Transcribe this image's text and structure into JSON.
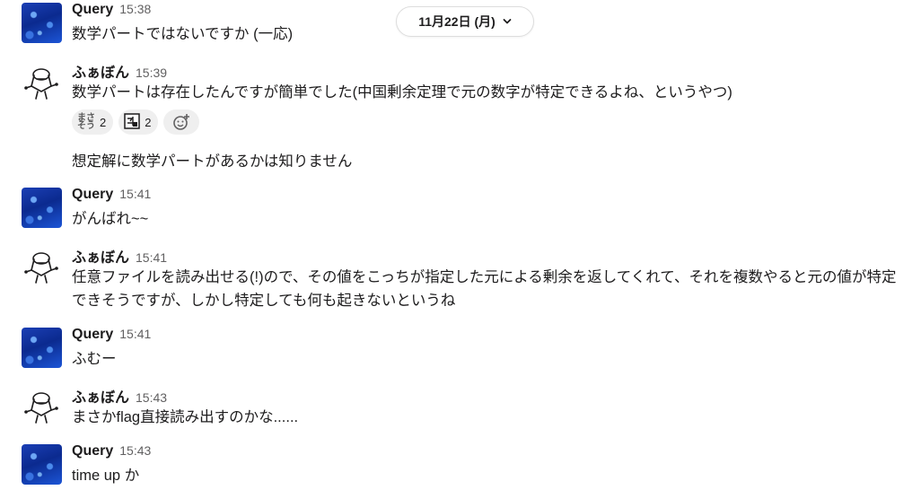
{
  "date_divider": {
    "label": "11月22日 (月)",
    "icon": "chevron-down-icon"
  },
  "messages": [
    {
      "name": "Query",
      "time": "15:38",
      "text": "数学パートではないですか (一応)",
      "avatar": "query"
    },
    {
      "name": "ふぁぼん",
      "time": "15:39",
      "text": "数学パートは存在したんですが簡単でした(中国剰余定理で元の数字が特定できるよね、というやつ)",
      "avatar": "fabon"
    },
    {
      "text": "想定解に数学パートがあるかは知りません"
    },
    {
      "name": "Query",
      "time": "15:41",
      "text": "がんばれ~~",
      "avatar": "query"
    },
    {
      "name": "ふぁぼん",
      "time": "15:41",
      "text": "任意ファイルを読み出せる(!)ので、その値をこっちが指定した元による剰余を返してくれて、それを複数やると元の値が特定できそうですが、しかし特定しても何も起きないというね",
      "avatar": "fabon"
    },
    {
      "name": "Query",
      "time": "15:41",
      "text": "ふむー",
      "avatar": "query"
    },
    {
      "name": "ふぁぼん",
      "time": "15:43",
      "text": "まさかflag直接読み出すのかな......",
      "avatar": "fabon"
    },
    {
      "name": "Query",
      "time": "15:43",
      "text": "time up か",
      "avatar": "query"
    }
  ],
  "reactions": [
    {
      "emoji_text": "まさ\nそう",
      "count": "2",
      "icon": "masasou-emoji-icon"
    },
    {
      "emoji_text": "",
      "count": "2",
      "icon": "kanji-tile-emoji-icon"
    }
  ],
  "add_reaction_icon": "add-reaction-icon"
}
